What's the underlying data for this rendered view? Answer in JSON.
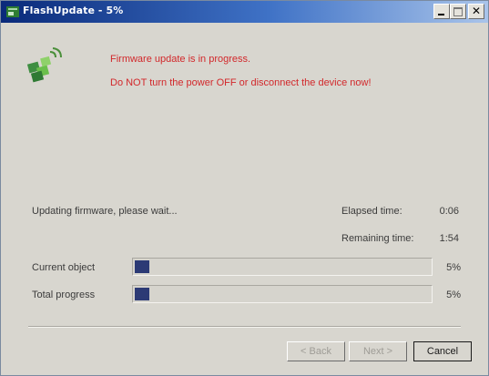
{
  "window": {
    "title": "FlashUpdate - 5%",
    "app_icon": "flashupdate-app-icon",
    "controls": {
      "minimize": "minimize-icon",
      "maximize": "maximize-icon",
      "close": "✕"
    }
  },
  "header": {
    "icon": "puzzle-update-icon",
    "warning_line1": "Firmware update is in progress.",
    "warning_line2": "Do NOT turn the power OFF or disconnect the device now!",
    "warning_color": "#d2282b"
  },
  "status": {
    "message": "Updating firmware, please wait...",
    "elapsed_label": "Elapsed time:",
    "elapsed_value": "0:06",
    "remaining_label": "Remaining time:",
    "remaining_value": "1:54"
  },
  "progress": [
    {
      "label": "Current object",
      "percent_text": "5%",
      "value": 0.05
    },
    {
      "label": "Total progress",
      "percent_text": "5%",
      "value": 0.05
    }
  ],
  "buttons": {
    "back": "< Back",
    "next": "Next >",
    "cancel": "Cancel"
  }
}
